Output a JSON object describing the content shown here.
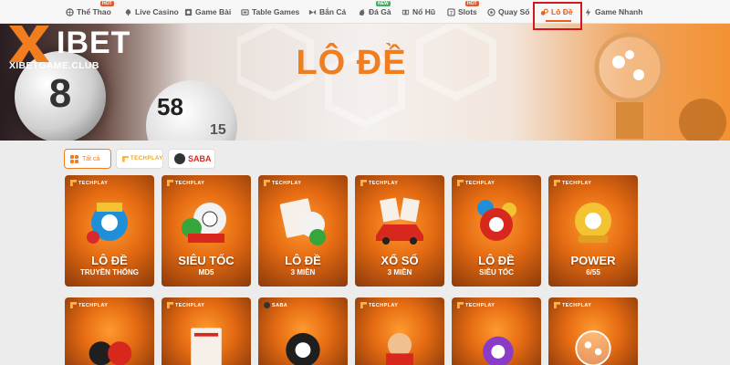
{
  "nav": {
    "items": [
      {
        "label": "Thể Thao",
        "icon": "sports-icon",
        "badge": "HOT"
      },
      {
        "label": "Live Casino",
        "icon": "casino-icon",
        "badge": ""
      },
      {
        "label": "Game Bài",
        "icon": "cards-icon",
        "badge": ""
      },
      {
        "label": "Table Games",
        "icon": "table-icon",
        "badge": ""
      },
      {
        "label": "Bắn Cá",
        "icon": "fish-icon",
        "badge": ""
      },
      {
        "label": "Đá Gà",
        "icon": "rooster-icon",
        "badge": "NEW"
      },
      {
        "label": "Nổ Hũ",
        "icon": "jackpot-icon",
        "badge": ""
      },
      {
        "label": "Slots",
        "icon": "slots-icon",
        "badge": "HOT"
      },
      {
        "label": "Quay Số",
        "icon": "lottery-wheel-icon",
        "badge": ""
      },
      {
        "label": "Lô Đề",
        "icon": "lo-de-icon",
        "badge": ""
      },
      {
        "label": "Game Nhanh",
        "icon": "lightning-icon",
        "badge": ""
      }
    ],
    "active": "Lô Đề"
  },
  "banner": {
    "logo_text": "IBET",
    "logo_sub": "XIBETGAME.CLUB",
    "title": "LÔ ĐỀ",
    "ball_big": "8",
    "ball_mid": "58",
    "ball_small": "15"
  },
  "filters": [
    {
      "label": "Tất cả",
      "active": true
    },
    {
      "label": "TECHPLAY",
      "active": false
    },
    {
      "label": "SABA",
      "active": false
    }
  ],
  "cards": [
    {
      "provider": "TECHPLAY",
      "title": "LÔ ĐỀ",
      "subtitle": "TRUYỀN THỐNG"
    },
    {
      "provider": "TECHPLAY",
      "title": "SIÊU TỐC",
      "subtitle": "MD5"
    },
    {
      "provider": "TECHPLAY",
      "title": "LÔ ĐỀ",
      "subtitle": "3 MIỀN"
    },
    {
      "provider": "TECHPLAY",
      "title": "XỔ SỐ",
      "subtitle": "3 MIỀN"
    },
    {
      "provider": "TECHPLAY",
      "title": "LÔ ĐỀ",
      "subtitle": "SIÊU TỐC"
    },
    {
      "provider": "TECHPLAY",
      "title": "POWER",
      "subtitle": "6/55"
    },
    {
      "provider": "TECHPLAY",
      "title": "",
      "subtitle": ""
    },
    {
      "provider": "TECHPLAY",
      "title": "",
      "subtitle": ""
    },
    {
      "provider": "SABA",
      "title": "",
      "subtitle": ""
    },
    {
      "provider": "TECHPLAY",
      "title": "",
      "subtitle": ""
    },
    {
      "provider": "TECHPLAY",
      "title": "",
      "subtitle": ""
    },
    {
      "provider": "TECHPLAY",
      "title": "",
      "subtitle": ""
    }
  ],
  "colors": {
    "accent": "#f07d1e",
    "highlight": "#d0181e"
  }
}
